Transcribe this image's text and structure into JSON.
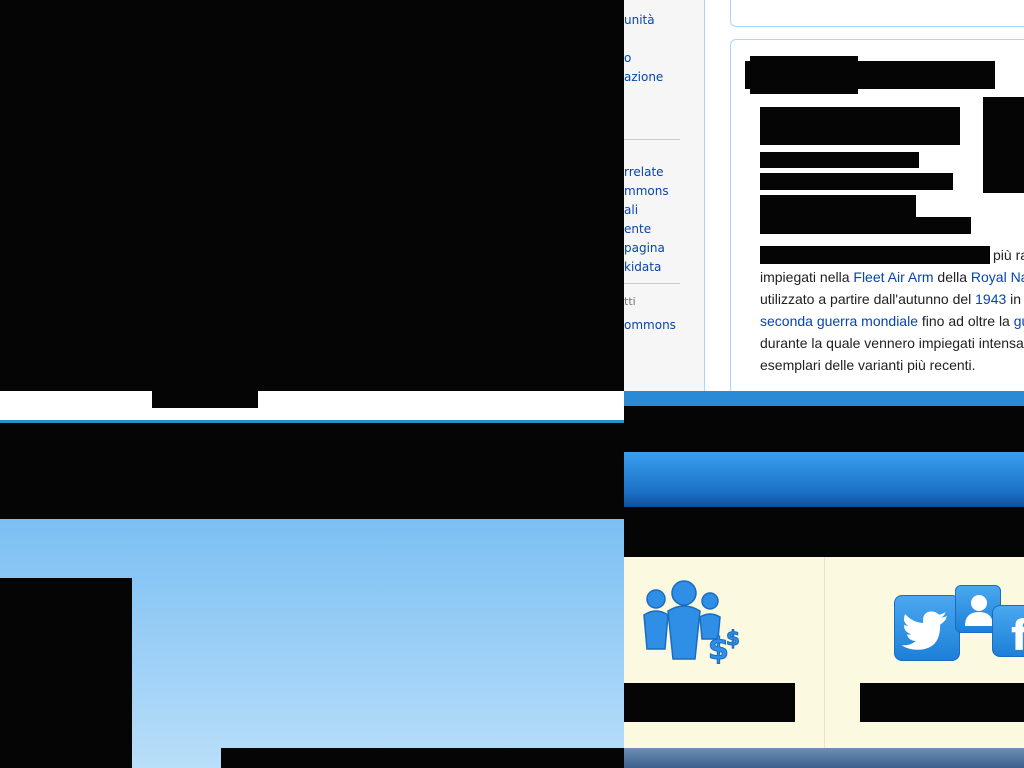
{
  "wiki": {
    "sidebar": {
      "top_links": [
        "unità",
        "o",
        "azione"
      ],
      "related_links": [
        "rrelate",
        "mmons",
        "ali",
        "ente",
        "pagina",
        "kidata"
      ],
      "section_label": "tti",
      "bottom_link": "ommons"
    },
    "article": {
      "line1_tail": "più ra",
      "line2": {
        "t1": "impiegati nella ",
        "l1": "Fleet Air Arm",
        "t2": " della ",
        "l2": "Royal Na"
      },
      "line3": {
        "t1": "utilizzato a partire dall'autunno del ",
        "l1": "1943",
        "t2": " in "
      },
      "line4": {
        "l1": "seconda guerra mondiale",
        "t1": " fino ad oltre la ",
        "l2": "gu"
      },
      "line5": "durante la quale vennero impiegati intensa",
      "line6": "esemplari delle varianti più recenti."
    }
  },
  "social": {
    "icons": [
      "group-money-icon",
      "twitter-icon",
      "contact-icon",
      "facebook-icon"
    ],
    "colors": {
      "background": "#fbf9df",
      "icon_blue": "#2f8ee6",
      "sky": "#8ccaf5"
    }
  }
}
